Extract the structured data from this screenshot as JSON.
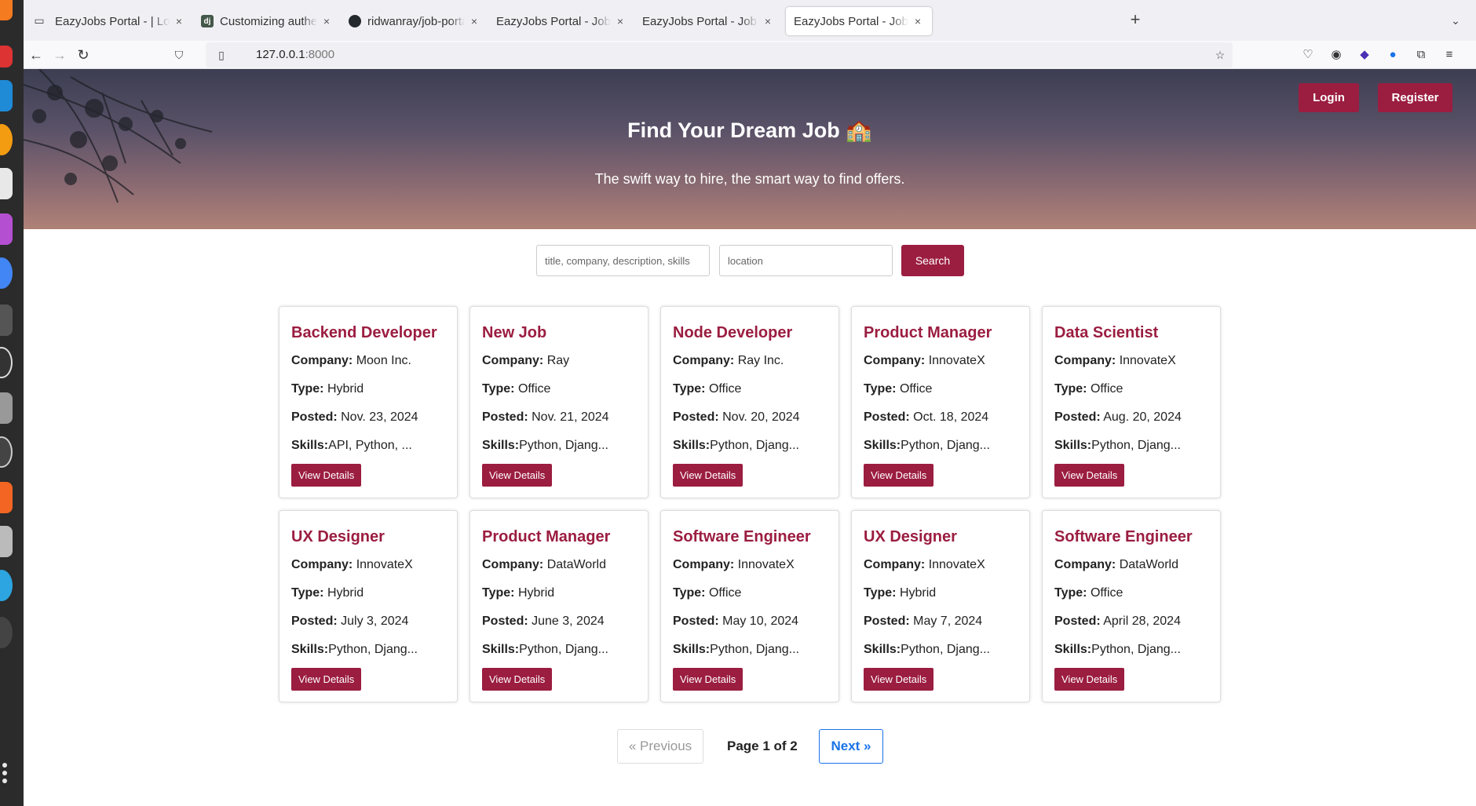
{
  "browser": {
    "tabs": [
      {
        "title": "EazyJobs Portal - | Login",
        "favicon": "none"
      },
      {
        "title": "Customizing authenticati",
        "favicon": "django-icon"
      },
      {
        "title": "ridwanray/job-portal-tem",
        "favicon": "github-icon"
      },
      {
        "title": "EazyJobs Portal - Job Portal",
        "favicon": "none"
      },
      {
        "title": "EazyJobs Portal - Job Portal",
        "favicon": "none"
      },
      {
        "title": "EazyJobs Portal - Job Portal",
        "favicon": "none",
        "active": true
      }
    ],
    "close_glyph": "×",
    "new_tab_glyph": "+",
    "url": {
      "host": "127.0.0.1",
      "port": ":8000"
    }
  },
  "colors": {
    "brand": "#9b1d40",
    "link_blue": "#1a73e8"
  },
  "hero": {
    "title": "Find Your Dream Job 🏫",
    "subtitle": "The swift way to hire, the smart way to find offers.",
    "login_label": "Login",
    "register_label": "Register"
  },
  "search": {
    "query_placeholder": "title, company, description, skills",
    "location_placeholder": "location",
    "button_label": "Search"
  },
  "labels": {
    "company": "Company:",
    "type": "Type:",
    "posted": "Posted:",
    "skills": "Skills:",
    "view": "View Details"
  },
  "jobs": [
    {
      "title": "Backend Developer",
      "company": "Moon Inc.",
      "type": "Hybrid",
      "posted": "Nov. 23, 2024",
      "skills": "API, Python, ..."
    },
    {
      "title": "New Job",
      "company": "Ray",
      "type": "Office",
      "posted": "Nov. 21, 2024",
      "skills": "Python, Djang..."
    },
    {
      "title": "Node Developer",
      "company": "Ray Inc.",
      "type": "Office",
      "posted": "Nov. 20, 2024",
      "skills": "Python, Djang..."
    },
    {
      "title": "Product Manager",
      "company": "InnovateX",
      "type": "Office",
      "posted": "Oct. 18, 2024",
      "skills": "Python, Djang..."
    },
    {
      "title": "Data Scientist",
      "company": "InnovateX",
      "type": "Office",
      "posted": "Aug. 20, 2024",
      "skills": "Python, Djang..."
    },
    {
      "title": "UX Designer",
      "company": "InnovateX",
      "type": "Hybrid",
      "posted": "July 3, 2024",
      "skills": "Python, Djang..."
    },
    {
      "title": "Product Manager",
      "company": "DataWorld",
      "type": "Hybrid",
      "posted": "June 3, 2024",
      "skills": "Python, Djang..."
    },
    {
      "title": "Software Engineer",
      "company": "InnovateX",
      "type": "Office",
      "posted": "May 10, 2024",
      "skills": "Python, Djang..."
    },
    {
      "title": "UX Designer",
      "company": "InnovateX",
      "type": "Hybrid",
      "posted": "May 7, 2024",
      "skills": "Python, Djang..."
    },
    {
      "title": "Software Engineer",
      "company": "DataWorld",
      "type": "Office",
      "posted": "April 28, 2024",
      "skills": "Python, Djang..."
    }
  ],
  "pagination": {
    "prev_label": "« Previous",
    "info": "Page 1 of 2",
    "next_label": "Next »"
  }
}
